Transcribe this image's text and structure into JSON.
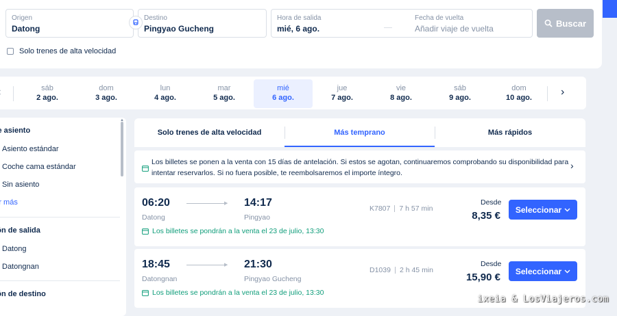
{
  "search": {
    "origin": {
      "label": "Origen",
      "value": "Datong"
    },
    "destination": {
      "label": "Destino",
      "value": "Pingyao Gucheng"
    },
    "departure": {
      "label": "Hora de salida",
      "value": "mié, 6 ago."
    },
    "return": {
      "label": "Fecha de vuelta",
      "placeholder": "Añadir viaje de vuelta"
    },
    "search_button": "Buscar",
    "high_speed_only": "Solo trenes de alta velocidad"
  },
  "date_strip": {
    "days": [
      {
        "weekday": "sáb",
        "date": "2 ago."
      },
      {
        "weekday": "dom",
        "date": "3 ago."
      },
      {
        "weekday": "lun",
        "date": "4 ago."
      },
      {
        "weekday": "mar",
        "date": "5 ago."
      },
      {
        "weekday": "mié",
        "date": "6 ago.",
        "active": true
      },
      {
        "weekday": "jue",
        "date": "7 ago."
      },
      {
        "weekday": "vie",
        "date": "8 ago."
      },
      {
        "weekday": "sáb",
        "date": "9 ago."
      },
      {
        "weekday": "dom",
        "date": "10 ago."
      }
    ]
  },
  "filters": {
    "seat_title": "o de asiento",
    "seat_options": [
      "Asiento estándar",
      "Coche cama estándar",
      "Sin asiento"
    ],
    "show_more": "strar más",
    "departure_station_title": "ación de salida",
    "departure_stations": [
      "Datong",
      "Datongnan"
    ],
    "arrival_station_title": "ación de destino"
  },
  "sort_tabs": {
    "tabs": [
      "Solo trenes de alta velocidad",
      "Más temprano",
      "Más rápidos"
    ],
    "active_index": 1
  },
  "notice": {
    "text": "Los billetes se ponen a la venta con 15 días de antelación. Si estos se agotan, continuaremos comprobando su disponibilidad para intentar reservarlos. Si no fuera posible, te reembolsaremos el importe íntegro."
  },
  "trains": [
    {
      "departure_time": "06:20",
      "arrival_time": "14:17",
      "departure_station": "Datong",
      "arrival_station": "Pingyao",
      "train_number": "K7807",
      "duration": "7 h 57 min",
      "price_prefix": "Desde",
      "price": "8,35 €",
      "select_label": "Seleccionar",
      "sale_notice": "Los billetes se pondrán a la venta el 23 de julio, 13:30"
    },
    {
      "departure_time": "18:45",
      "arrival_time": "21:30",
      "departure_station": "Datongnan",
      "arrival_station": "Pingyao Gucheng",
      "train_number": "D1039",
      "duration": "2 h 45 min",
      "price_prefix": "Desde",
      "price": "15,90 €",
      "select_label": "Seleccionar",
      "sale_notice": "Los billetes se pondrán a la venta el 23 de julio, 13:30"
    }
  ],
  "watermark": "ixeia & LosViajeros.com",
  "colors": {
    "accent": "#3264ff",
    "text": "#0f294d",
    "muted": "#8592a6",
    "sale": "#0f9d7a",
    "disabled_button": "#b7bec9"
  }
}
